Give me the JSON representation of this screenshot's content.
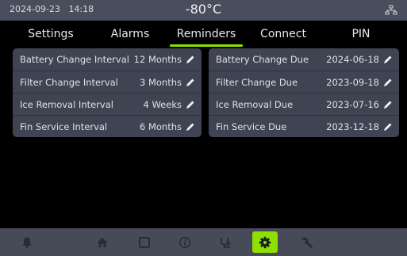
{
  "status": {
    "date": "2024-09-23",
    "time": "14:18",
    "temperature": "-80°C",
    "network_icon": "network-icon"
  },
  "tabs": [
    {
      "label": "Settings"
    },
    {
      "label": "Alarms"
    },
    {
      "label": "Reminders",
      "active": true
    },
    {
      "label": "Connect"
    },
    {
      "label": "PIN"
    }
  ],
  "intervals": [
    {
      "label": "Battery Change Interval",
      "value": "12 Months"
    },
    {
      "label": "Filter Change Interval",
      "value": "3 Months"
    },
    {
      "label": "Ice Removal Interval",
      "value": "4 Weeks"
    },
    {
      "label": "Fin Service Interval",
      "value": "6 Months"
    }
  ],
  "due_dates": [
    {
      "label": "Battery Change Due",
      "value": "2024-06-18"
    },
    {
      "label": "Filter Change Due",
      "value": "2023-09-18"
    },
    {
      "label": "Ice Removal Due",
      "value": "2023-07-16"
    },
    {
      "label": "Fin Service Due",
      "value": "2023-12-18"
    }
  ],
  "nav": [
    {
      "icon": "alarm-bell-icon"
    },
    {
      "icon": "home-icon"
    },
    {
      "icon": "square-icon"
    },
    {
      "icon": "info-icon"
    },
    {
      "icon": "service-icon"
    },
    {
      "icon": "settings-gear-icon",
      "active": true
    },
    {
      "icon": "wrench-icon"
    }
  ],
  "colors": {
    "accent": "#8ee000",
    "status_bar": "#4a4d5c",
    "panel": "#3f4352",
    "nav_bar": "#474a57",
    "nav_icon": "#2a2c35"
  }
}
